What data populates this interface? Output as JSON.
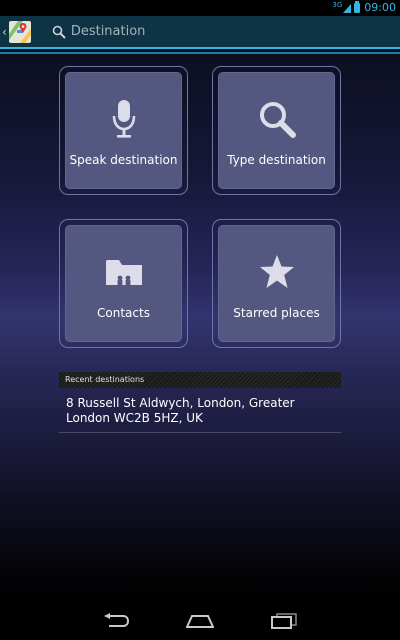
{
  "status_bar": {
    "network": "3G",
    "time": "09:00"
  },
  "action_bar": {
    "search_placeholder": "Destination"
  },
  "tiles": {
    "speak": {
      "label": "Speak destination",
      "icon": "microphone-icon"
    },
    "type": {
      "label": "Type destination",
      "icon": "search-icon"
    },
    "contacts": {
      "label": "Contacts",
      "icon": "contacts-folder-icon"
    },
    "starred": {
      "label": "Starred places",
      "icon": "star-icon"
    }
  },
  "recent": {
    "header": "Recent destinations",
    "items": [
      {
        "address": "8 Russell St Aldwych, London, Greater London WC2B 5HZ, UK"
      }
    ]
  },
  "nav_bar": {
    "buttons": [
      "back-icon",
      "home-icon",
      "recent-apps-icon"
    ]
  },
  "colors": {
    "accent": "#33b5e5",
    "tile_fill": "#54577f",
    "tile_border": "#6f74a6",
    "action_bar": "#0d3344"
  }
}
